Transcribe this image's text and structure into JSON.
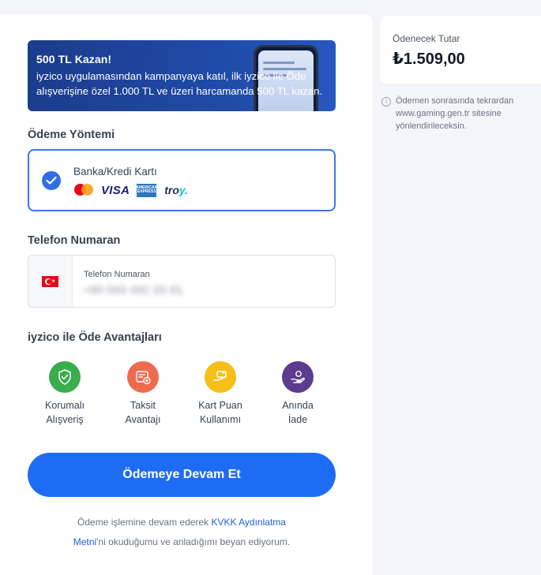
{
  "banner": {
    "title": "500 TL Kazan!",
    "text": "iyzico uygulamasından kampanyaya katıl, ilk iyzico ile Öde alışverişine özel 1.000 TL ve üzeri harcamanda 500 TL kazan."
  },
  "payment_method": {
    "section_title": "Ödeme Yöntemi",
    "option_label": "Banka/Kredi Kartı",
    "logos": {
      "visa": "VISA",
      "amex": "AMERICAN EXPRESS",
      "troy_main": "tro",
      "troy_end": "y."
    }
  },
  "phone": {
    "section_title": "Telefon Numaran",
    "field_label": "Telefon Numaran",
    "value": "+90 544 442 33 91",
    "flag_star": "★"
  },
  "advantages": {
    "section_title": "iyzico ile Öde Avantajları",
    "items": [
      {
        "line1": "Korumalı",
        "line2": "Alışveriş",
        "color": "#3aad4c",
        "icon": "shield-check-icon"
      },
      {
        "line1": "Taksit",
        "line2": "Avantajı",
        "color": "#f06a4e",
        "icon": "installment-card-icon"
      },
      {
        "line1": "Kart Puan",
        "line2": "Kullanımı",
        "color": "#f5bf17",
        "icon": "card-points-icon"
      },
      {
        "line1": "Anında",
        "line2": "İade",
        "color": "#5b3c8f",
        "icon": "instant-refund-icon"
      }
    ]
  },
  "cta": {
    "label": "Ödemeye Devam Et",
    "color": "#1e6cf4"
  },
  "consent": {
    "prefix": "Ödeme işlemine devam ederek ",
    "link1": "KVKK Aydınlatma",
    "link2": "Metni",
    "suffix": "'ni okuduğumu ve anladığımı beyan ediyorum."
  },
  "summary": {
    "label": "Ödenecek Tutar",
    "amount": "₺1.509,00"
  },
  "info": {
    "icon_glyph": "i",
    "text": "Ödemen sonrasında tekrardan www.gaming.gen.tr sitesine yönlendirileceksin."
  }
}
